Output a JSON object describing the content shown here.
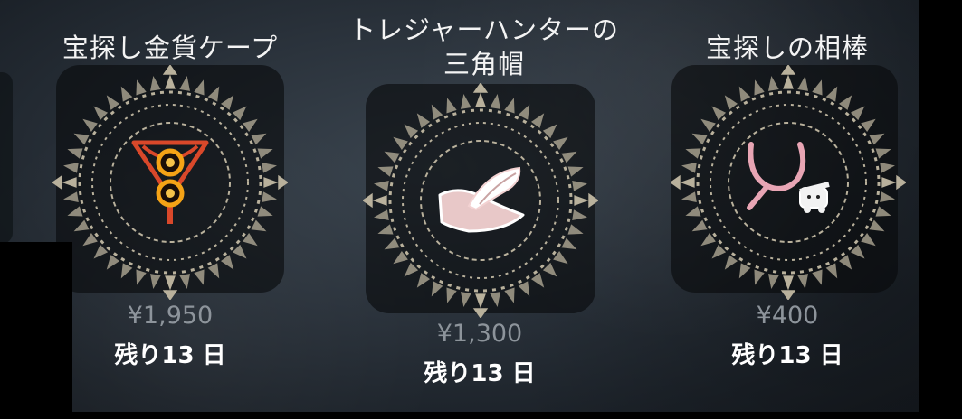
{
  "items": [
    {
      "title_lines": [
        "宝探し金貨ケープ"
      ],
      "price": "¥1,950",
      "remaining": "残り13 日",
      "icon": "gold-coin-cape-icon",
      "accent": "#e0562a"
    },
    {
      "title_lines": [
        "トレジャーハンターの",
        "三角帽"
      ],
      "price": "¥1,300",
      "remaining": "残り13 日",
      "icon": "tricorn-hat-icon",
      "accent": "#f3d2d2"
    },
    {
      "title_lines": [
        "宝探しの相棒"
      ],
      "price": "¥400",
      "remaining": "残り13 日",
      "icon": "treasure-buddy-icon",
      "accent": "#e8a5b4"
    }
  ],
  "colors": {
    "ring": "#b9b19c",
    "price": "#8d949b",
    "text": "#ffffff"
  }
}
